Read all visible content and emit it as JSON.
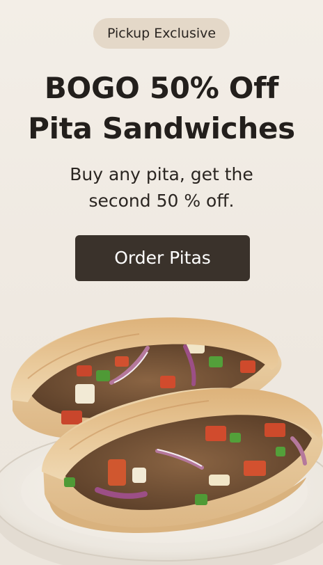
{
  "promo": {
    "badge": "Pickup Exclusive",
    "headline_line1": "BOGO 50% Off",
    "headline_line2": "Pita Sandwiches",
    "subhead_line1": "Buy any pita, get the",
    "subhead_line2": "second 50 % off.",
    "cta_label": "Order Pitas"
  },
  "colors": {
    "background": "#efe9e0",
    "badge_background": "#e4d8c8",
    "cta_background": "#3a322b",
    "text": "#231f1c"
  }
}
